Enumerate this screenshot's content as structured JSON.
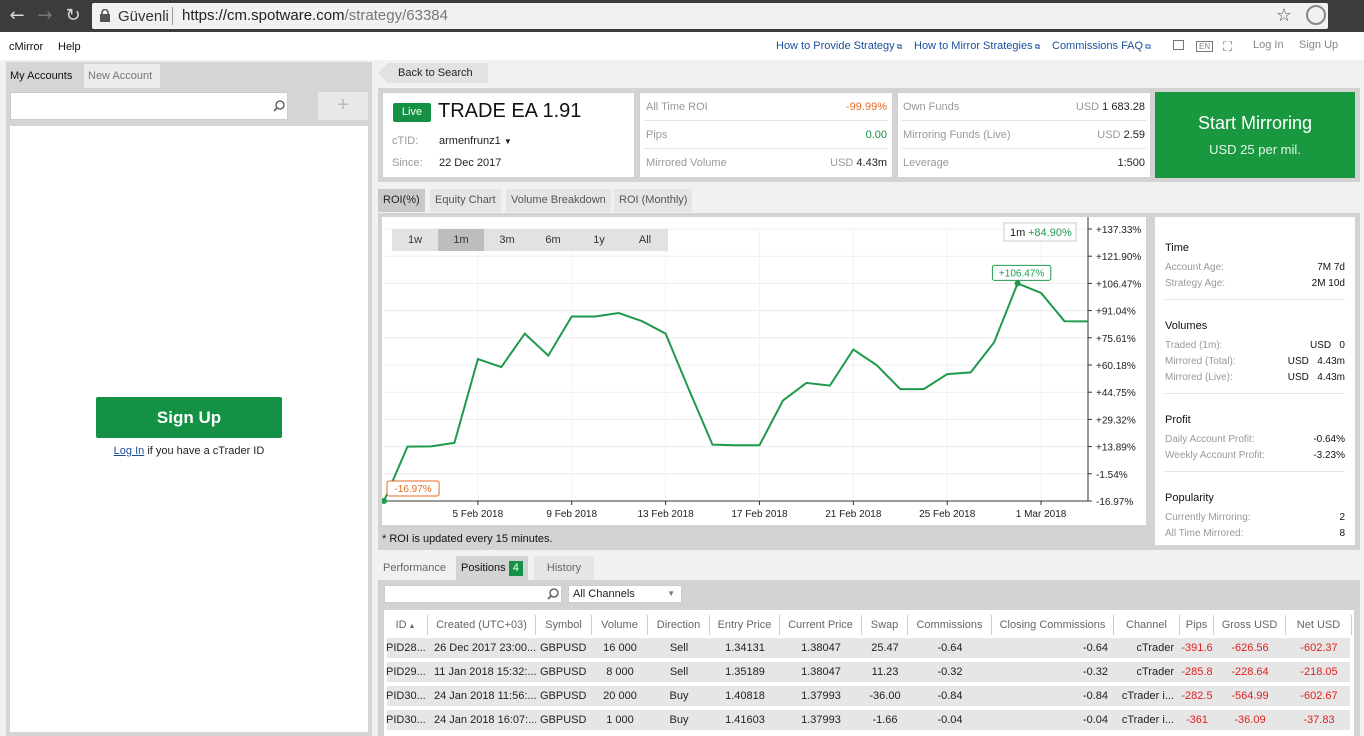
{
  "browser": {
    "secure_label": "Güvenli",
    "url_host": "https://cm.spotware.com",
    "url_path": "/strategy/63384"
  },
  "topmenu": {
    "app": "cMirror",
    "help": "Help",
    "links": [
      "How to Provide Strategy",
      "How to Mirror Strategies",
      "Commissions FAQ"
    ],
    "lang": "EN",
    "login": "Log In",
    "signup": "Sign Up"
  },
  "left": {
    "tabs": [
      "My Accounts",
      "New Account"
    ],
    "plus": "+",
    "signup_button": "Sign Up",
    "login_link": "Log In",
    "login_suffix": " if you have a cTrader ID"
  },
  "back_button": "Back to Search",
  "strategy": {
    "status": "Live",
    "name": "TRADE EA 1.91",
    "ctid_label": "cTID:",
    "ctid": "armenfrunz1",
    "since_label": "Since:",
    "since": "22 Dec 2017"
  },
  "metrics": {
    "all_time_roi_label": "All Time ROI",
    "all_time_roi": "-99.99%",
    "pips_label": "Pips",
    "pips": "0.00",
    "mirrored_volume_label": "Mirrored Volume",
    "mirrored_volume_cur": "USD",
    "mirrored_volume": "4.43m"
  },
  "funds": {
    "own_label": "Own Funds",
    "own_cur": "USD",
    "own": "1 683.28",
    "mirroring_label": "Mirroring Funds (Live)",
    "mirroring_cur": "USD",
    "mirroring": "2.59",
    "leverage_label": "Leverage",
    "leverage": "1:500"
  },
  "start": {
    "title": "Start Mirroring",
    "price": "USD 25 per mil."
  },
  "chart_tabs": [
    "ROI(%)",
    "Equity Chart",
    "Volume Breakdown",
    "ROI (Monthly)"
  ],
  "ranges": [
    "1w",
    "1m",
    "3m",
    "6m",
    "1y",
    "All"
  ],
  "chart_data": {
    "type": "line",
    "x": [
      "2018-02-01",
      "2018-02-02",
      "2018-02-03",
      "2018-02-04",
      "2018-02-05",
      "2018-02-06",
      "2018-02-07",
      "2018-02-08",
      "2018-02-09",
      "2018-02-10",
      "2018-02-11",
      "2018-02-12",
      "2018-02-13",
      "2018-02-14",
      "2018-02-15",
      "2018-02-16",
      "2018-02-17",
      "2018-02-18",
      "2018-02-19",
      "2018-02-20",
      "2018-02-21",
      "2018-02-22",
      "2018-02-23",
      "2018-02-24",
      "2018-02-25",
      "2018-02-26",
      "2018-02-27",
      "2018-02-28",
      "2018-03-01",
      "2018-03-02",
      "2018-03-03"
    ],
    "values": [
      -16.97,
      13.9,
      14.0,
      16.0,
      63.5,
      59.0,
      78.0,
      65.5,
      87.7,
      87.7,
      89.7,
      85.0,
      78.0,
      46.0,
      15.0,
      14.7,
      14.7,
      40.0,
      50.0,
      48.5,
      69.0,
      60.0,
      46.5,
      46.5,
      55.0,
      56.0,
      73.0,
      106.47,
      101.0,
      85.0,
      84.9
    ],
    "ylim": [
      -16.97,
      137.33
    ],
    "y_ticks": [
      "+137.33%",
      "+121.90%",
      "+106.47%",
      "+91.04%",
      "+75.61%",
      "+60.18%",
      "+44.75%",
      "+29.32%",
      "+13.89%",
      "-1.54%",
      "-16.97%"
    ],
    "x_ticks": [
      "5 Feb 2018",
      "9 Feb 2018",
      "13 Feb 2018",
      "17 Feb 2018",
      "21 Feb 2018",
      "25 Feb 2018",
      "1 Mar 2018"
    ],
    "x_tick_values": [
      "2018-02-05",
      "2018-02-09",
      "2018-02-13",
      "2018-02-17",
      "2018-02-21",
      "2018-02-25",
      "2018-03-01"
    ],
    "annotations": [
      {
        "text": "-16.97%",
        "x": "2018-02-01",
        "y": -16.97
      },
      {
        "text": "+106.47%",
        "x": "2018-02-28",
        "y": 106.47
      }
    ],
    "period_label": "1m",
    "period_value": "+84.90%",
    "grid": true,
    "color": "#1f9a4c"
  },
  "roi_note": "* ROI is updated every 15 minutes.",
  "stats": {
    "time_title": "Time",
    "account_age_label": "Account Age:",
    "account_age": "7M 7d",
    "strategy_age_label": "Strategy Age:",
    "strategy_age": "2M 10d",
    "volumes_title": "Volumes",
    "traded_label": "Traded (1m):",
    "traded": "USD   0",
    "mirrored_total_label": "Mirrored (Total):",
    "mirrored_total": "USD   4.43m",
    "mirrored_live_label": "Mirrored (Live):",
    "mirrored_live": "USD   4.43m",
    "profit_title": "Profit",
    "daily_label": "Daily Account Profit:",
    "daily": "-0.64%",
    "weekly_label": "Weekly Account Profit:",
    "weekly": "-3.23%",
    "popularity_title": "Popularity",
    "currently_label": "Currently Mirroring:",
    "currently": "2",
    "alltime_label": "All Time Mirrored:",
    "alltime": "8"
  },
  "bottom_tabs": {
    "performance": "Performance",
    "positions": "Positions",
    "positions_count": "4",
    "history": "History"
  },
  "channel_select": "All Channels",
  "positions": {
    "headers": [
      "ID",
      "Created (UTC+03)",
      "Symbol",
      "Volume",
      "Direction",
      "Entry Price",
      "Current Price",
      "Swap",
      "Commissions",
      "Closing Commissions",
      "Channel",
      "Pips",
      "Gross USD",
      "Net USD"
    ],
    "rows": [
      [
        "PID28...",
        "26 Dec 2017 23:00...",
        "GBPUSD",
        "16 000",
        "Sell",
        "1.34131",
        "1.38047",
        "25.47",
        "-0.64",
        "-0.64",
        "cTrader",
        "-391.6",
        "-626.56",
        "-602.37"
      ],
      [
        "PID29...",
        "11 Jan 2018 15:32:...",
        "GBPUSD",
        "8 000",
        "Sell",
        "1.35189",
        "1.38047",
        "11.23",
        "-0.32",
        "-0.32",
        "cTrader",
        "-285.8",
        "-228.64",
        "-218.05"
      ],
      [
        "PID30...",
        "24 Jan 2018 11:56:...",
        "GBPUSD",
        "20 000",
        "Buy",
        "1.40818",
        "1.37993",
        "-36.00",
        "-0.84",
        "-0.84",
        "cTrader i...",
        "-282.5",
        "-564.99",
        "-602.67"
      ],
      [
        "PID30...",
        "24 Jan 2018 16:07:...",
        "GBPUSD",
        "1 000",
        "Buy",
        "1.41603",
        "1.37993",
        "-1.66",
        "-0.04",
        "-0.04",
        "cTrader i...",
        "-361",
        "-36.09",
        "-37.83"
      ]
    ]
  }
}
